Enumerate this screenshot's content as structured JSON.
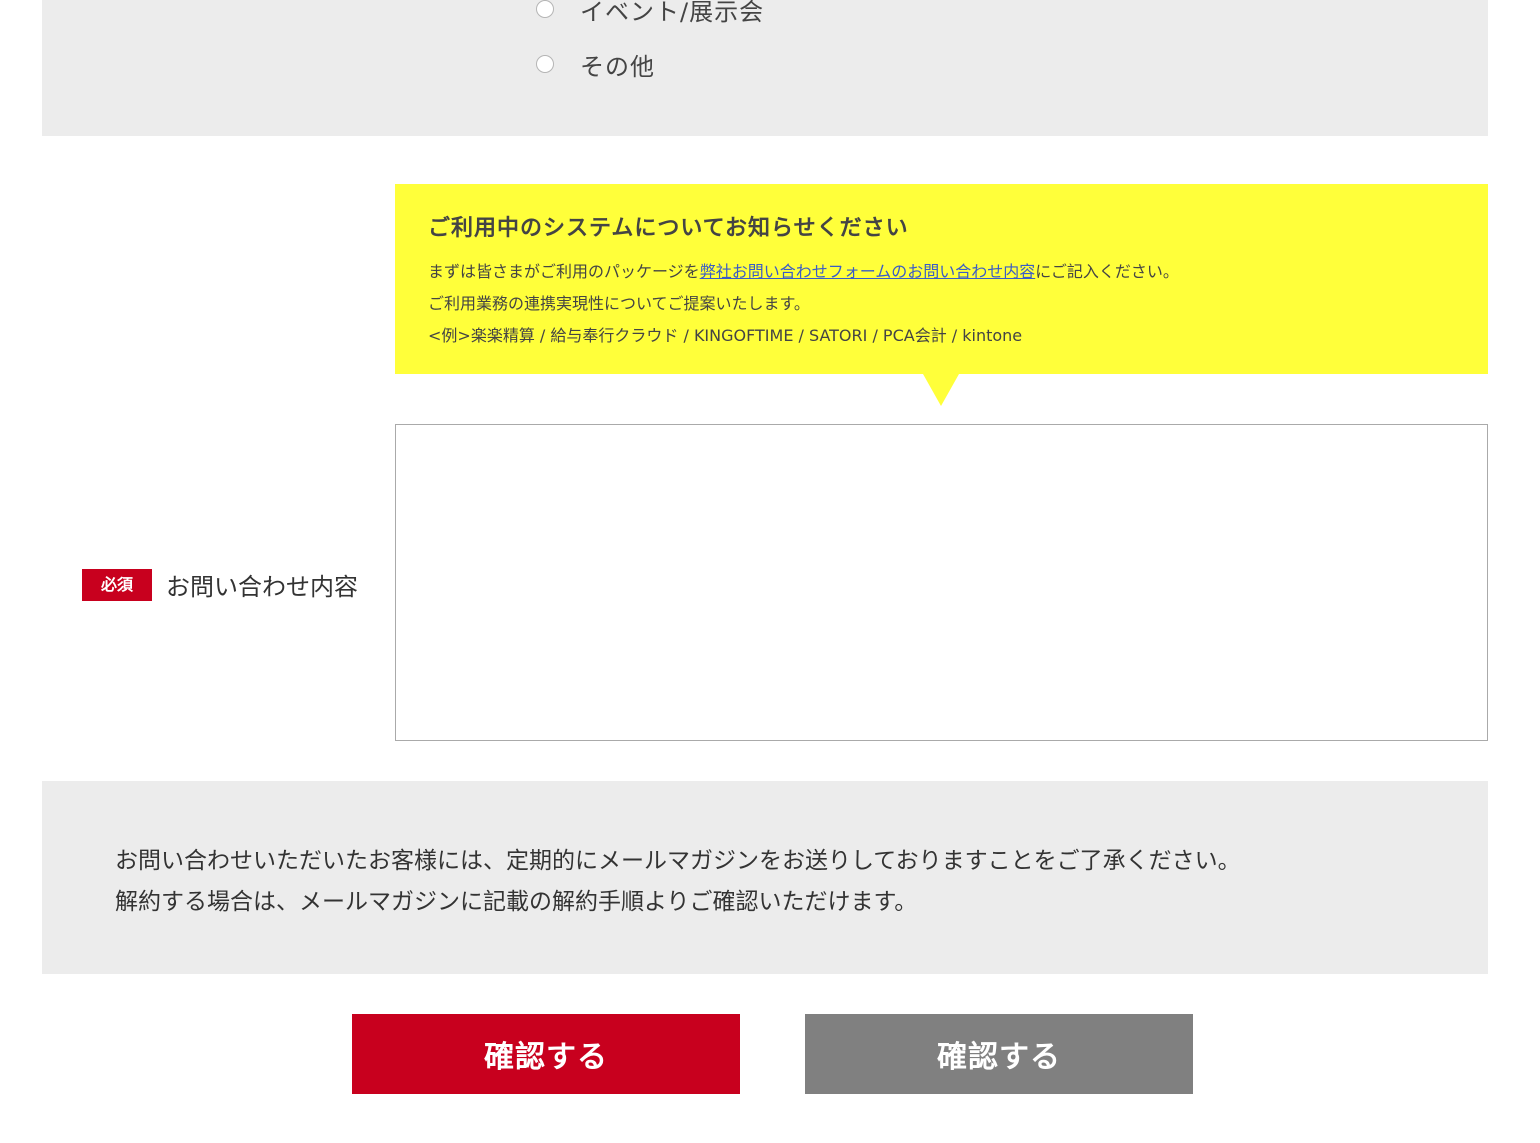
{
  "radio_options": [
    {
      "label": "イベント/展示会",
      "selected": false
    },
    {
      "label": "その他",
      "selected": false
    }
  ],
  "bubble": {
    "title": "ご利用中のシステムについてお知らせください",
    "line1_prefix": "まずは皆さまがご利用のパッケージを",
    "line1_link": "弊社お問い合わせフォームのお問い合わせ内容",
    "line1_suffix": "にご記入ください。",
    "line2": "ご利用業務の連携実現性についてご提案いたします。",
    "line3": "<例>楽楽精算 / 給与奉行クラウド / KINGOFTIME / SATORI / PCA会計 / kintone",
    "background_color": "#ffff3a",
    "link_color": "#3a5cc7"
  },
  "inquiry_field": {
    "required_badge": "必須",
    "label": "お問い合わせ内容",
    "value": "",
    "badge_color": "#c8001e"
  },
  "notice": {
    "line1": "お問い合わせいただいたお客様には、定期的にメールマガジンをお送りしておりますことをご了承ください。",
    "line2": "解約する場合は、メールマガジンに記載の解約手順よりご確認いただけます。"
  },
  "buttons": {
    "primary_label": "確認する",
    "secondary_label": "確認する",
    "primary_color": "#c8001e",
    "secondary_color": "#808080"
  }
}
